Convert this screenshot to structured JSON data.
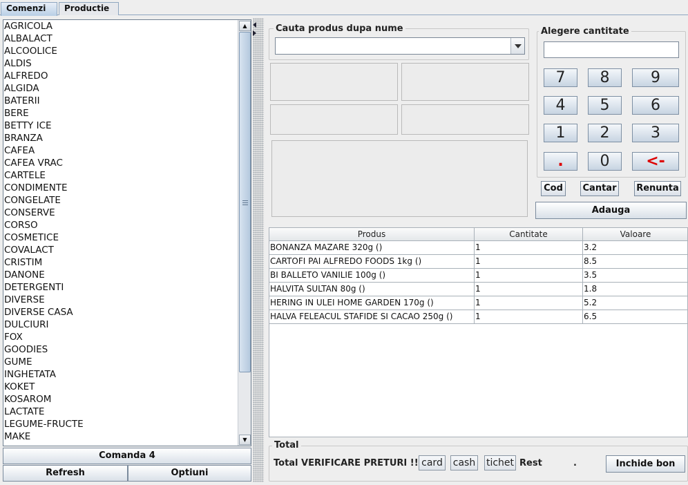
{
  "tabs": [
    {
      "label": "Comenzi",
      "active": true
    },
    {
      "label": "Productie",
      "active": false
    }
  ],
  "categories": [
    "AGRICOLA",
    "ALBALACT",
    "ALCOOLICE",
    "ALDIS",
    "ALFREDO",
    "ALGIDA",
    "BATERII",
    "BERE",
    "BETTY ICE",
    "BRANZA",
    "CAFEA",
    "CAFEA VRAC",
    "CARTELE",
    "CONDIMENTE",
    "CONGELATE",
    "CONSERVE",
    "CORSO",
    "COSMETICE",
    "COVALACT",
    "CRISTIM",
    "DANONE",
    "DETERGENTI",
    "DIVERSE",
    "DIVERSE CASA",
    "DULCIURI",
    "FOX",
    "GOODIES",
    "GUME",
    "INGHETATA",
    "KOKET",
    "KOSAROM",
    "LACTATE",
    "LEGUME-FRUCTE",
    "MAKE"
  ],
  "left_buttons": {
    "comanda": "Comanda 4",
    "refresh": "Refresh",
    "optiuni": "Optiuni"
  },
  "search": {
    "label": "Cauta produs dupa nume",
    "value": ""
  },
  "quantity": {
    "label": "Alegere cantitate",
    "value": "",
    "keys": [
      "7",
      "8",
      "9",
      "4",
      "5",
      "6",
      "1",
      "2",
      "3",
      ".",
      "0",
      "<-"
    ],
    "cod": "Cod",
    "cantar": "Cantar",
    "renunta": "Renunta",
    "adauga": "Adauga"
  },
  "table": {
    "columns": [
      "Produs",
      "Cantitate",
      "Valoare"
    ],
    "rows": [
      [
        "BONANZA MAZARE 320g ()",
        "1",
        "3.2"
      ],
      [
        "CARTOFI PAI ALFREDO FOODS 1kg ()",
        "1",
        "8.5"
      ],
      [
        " BI BALLETO VANILIE 100g ()",
        "1",
        "3.5"
      ],
      [
        "HALVITA SULTAN 80g ()",
        "1",
        "1.8"
      ],
      [
        "HERING IN ULEI HOME GARDEN 170g ()",
        "1",
        "5.2"
      ],
      [
        "HALVA FELEACUL STAFIDE SI CACAO 250g ()",
        "1",
        "6.5"
      ]
    ]
  },
  "total": {
    "label": "Total",
    "value_text": "Total VERIFICARE PRETURI !!",
    "card": "card",
    "cash": "cash",
    "tichet": "tichet",
    "rest_label": "Rest",
    "rest_value": ".",
    "inchide": "Inchide bon"
  },
  "colors": {
    "accent": "#b8cfe6",
    "key_red": "#dd0000"
  }
}
